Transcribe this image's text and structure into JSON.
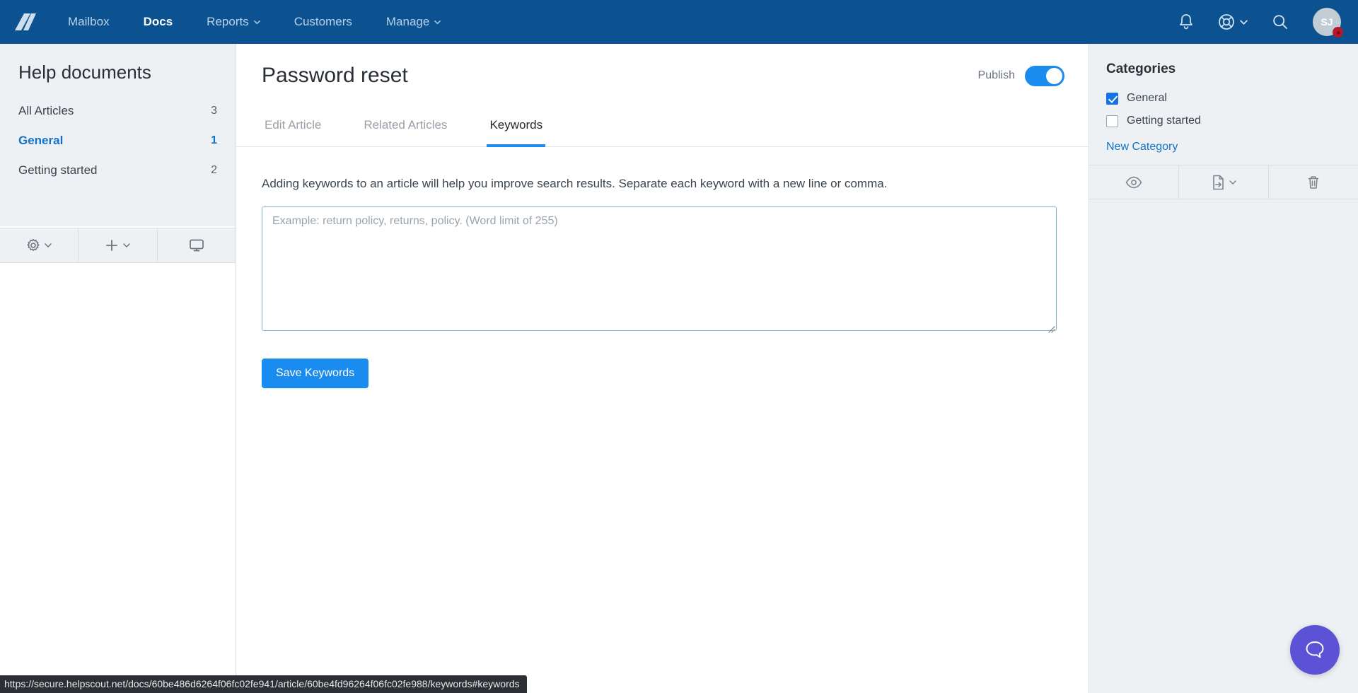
{
  "topnav": {
    "logo": "helpscout-logo",
    "items": [
      {
        "label": "Mailbox",
        "active": false,
        "caret": false
      },
      {
        "label": "Docs",
        "active": true,
        "caret": false
      },
      {
        "label": "Reports",
        "active": false,
        "caret": true
      },
      {
        "label": "Customers",
        "active": false,
        "caret": false
      },
      {
        "label": "Manage",
        "active": false,
        "caret": true
      }
    ],
    "notifications_icon": "bell-icon",
    "help_icon": "lifebuoy-icon",
    "search_icon": "search-icon",
    "avatar_initials": "SJ"
  },
  "sidebar": {
    "title": "Help documents",
    "items": [
      {
        "label": "All Articles",
        "count": "3",
        "active": false
      },
      {
        "label": "General",
        "count": "1",
        "active": true
      },
      {
        "label": "Getting started",
        "count": "2",
        "active": false
      }
    ],
    "tools": [
      {
        "icon": "gear-icon",
        "caret": true
      },
      {
        "icon": "plus-icon",
        "caret": true
      },
      {
        "icon": "monitor-preview-icon",
        "caret": false
      }
    ]
  },
  "main": {
    "article_title": "Password reset",
    "publish_label": "Publish",
    "publish_on": true,
    "tabs": [
      {
        "label": "Edit Article",
        "active": false
      },
      {
        "label": "Related Articles",
        "active": false
      },
      {
        "label": "Keywords",
        "active": true
      }
    ],
    "description": "Adding keywords to an article will help you improve search results. Separate each keyword with a new line or comma.",
    "keywords_value": "",
    "keywords_placeholder": "Example: return policy, returns, policy. (Word limit of 255)",
    "save_label": "Save Keywords"
  },
  "rightpanel": {
    "title": "Categories",
    "categories": [
      {
        "label": "General",
        "checked": true
      },
      {
        "label": "Getting started",
        "checked": false
      }
    ],
    "new_category_label": "New Category",
    "tools": [
      {
        "icon": "eye-preview-icon",
        "caret": false
      },
      {
        "icon": "move-article-icon",
        "caret": true
      },
      {
        "icon": "trash-icon",
        "caret": false
      }
    ]
  },
  "beacon": {
    "icon": "chat-bubble-icon"
  },
  "statusbar": {
    "url": "https://secure.helpscout.net/docs/60be486d6264f06fc02fe941/article/60be4fd96264f06fc02fe988/keywords#keywords"
  },
  "colors": {
    "nav_blue": "#0c5291",
    "accent_blue": "#1a8cf0",
    "link_blue": "#1273c6",
    "panel_gray": "#eef1f4",
    "beacon_purple": "#5c52d6",
    "badge_red": "#b8172b"
  }
}
